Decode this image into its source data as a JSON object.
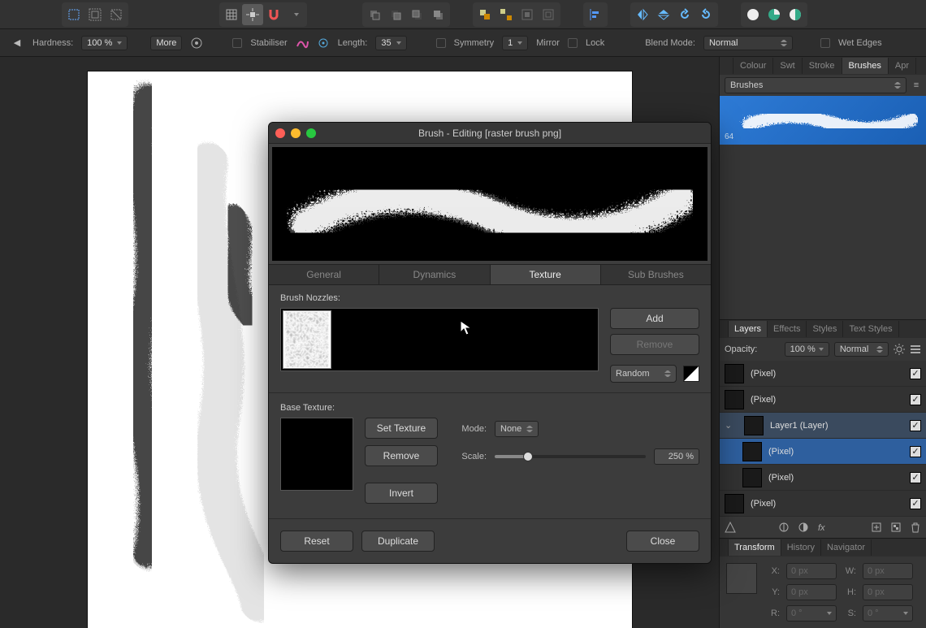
{
  "toolbar2": {
    "hardness_label": "Hardness:",
    "hardness_value": "100 %",
    "more_label": "More",
    "stabiliser_label": "Stabiliser",
    "length_label": "Length:",
    "length_value": "35",
    "symmetry_label": "Symmetry",
    "symmetry_value": "1",
    "mirror_label": "Mirror",
    "lock_label": "Lock",
    "blendmode_label": "Blend Mode:",
    "blendmode_value": "Normal",
    "wetedges_label": "Wet Edges"
  },
  "studio": {
    "tabs": {
      "colour": "Colour",
      "swatch": "Swt",
      "stroke": "Stroke",
      "brushes": "Brushes",
      "appearance": "Apr"
    },
    "brush_category": "Brushes",
    "brush_size": "64"
  },
  "layers_panel": {
    "tabs": {
      "layers": "Layers",
      "effects": "Effects",
      "styles": "Styles",
      "text_styles": "Text Styles"
    },
    "opacity_label": "Opacity:",
    "opacity_value": "100 %",
    "blend_value": "Normal",
    "layers": [
      {
        "name": "(Pixel)",
        "checked": true,
        "selected": false,
        "indent": 0,
        "dark": true
      },
      {
        "name": "(Pixel)",
        "checked": true,
        "selected": false,
        "indent": 0,
        "dark": true
      },
      {
        "name": "Layer1 (Layer)",
        "checked": true,
        "selected": false,
        "indent": 0,
        "parent": true,
        "dark": true
      },
      {
        "name": "(Pixel)",
        "checked": true,
        "selected": true,
        "indent": 1,
        "dark": true
      },
      {
        "name": "(Pixel)",
        "checked": true,
        "selected": false,
        "indent": 1,
        "dark": true
      },
      {
        "name": "(Pixel)",
        "checked": true,
        "selected": false,
        "indent": 0,
        "dark": true
      }
    ]
  },
  "transform_panel": {
    "tabs": {
      "transform": "Transform",
      "history": "History",
      "navigator": "Navigator"
    },
    "x_label": "X:",
    "x_value": "0 px",
    "y_label": "Y:",
    "y_value": "0 px",
    "w_label": "W:",
    "w_value": "0 px",
    "h_label": "H:",
    "h_value": "0 px",
    "r_label": "R:",
    "r_value": "0 °",
    "s_label": "S:",
    "s_value": "0 °"
  },
  "dialog": {
    "title": "Brush - Editing [raster brush png]",
    "tabs": {
      "general": "General",
      "dynamics": "Dynamics",
      "texture": "Texture",
      "sub": "Sub Brushes"
    },
    "nozzles_label": "Brush Nozzles:",
    "add_btn": "Add",
    "remove_btn": "Remove",
    "nozzle_mode": "Random",
    "base_texture_label": "Base Texture:",
    "set_texture_btn": "Set Texture",
    "remove_tex_btn": "Remove",
    "invert_btn": "Invert",
    "mode_label": "Mode:",
    "mode_value": "None",
    "scale_label": "Scale:",
    "scale_value": "250 %",
    "reset_btn": "Reset",
    "duplicate_btn": "Duplicate",
    "close_btn": "Close"
  }
}
